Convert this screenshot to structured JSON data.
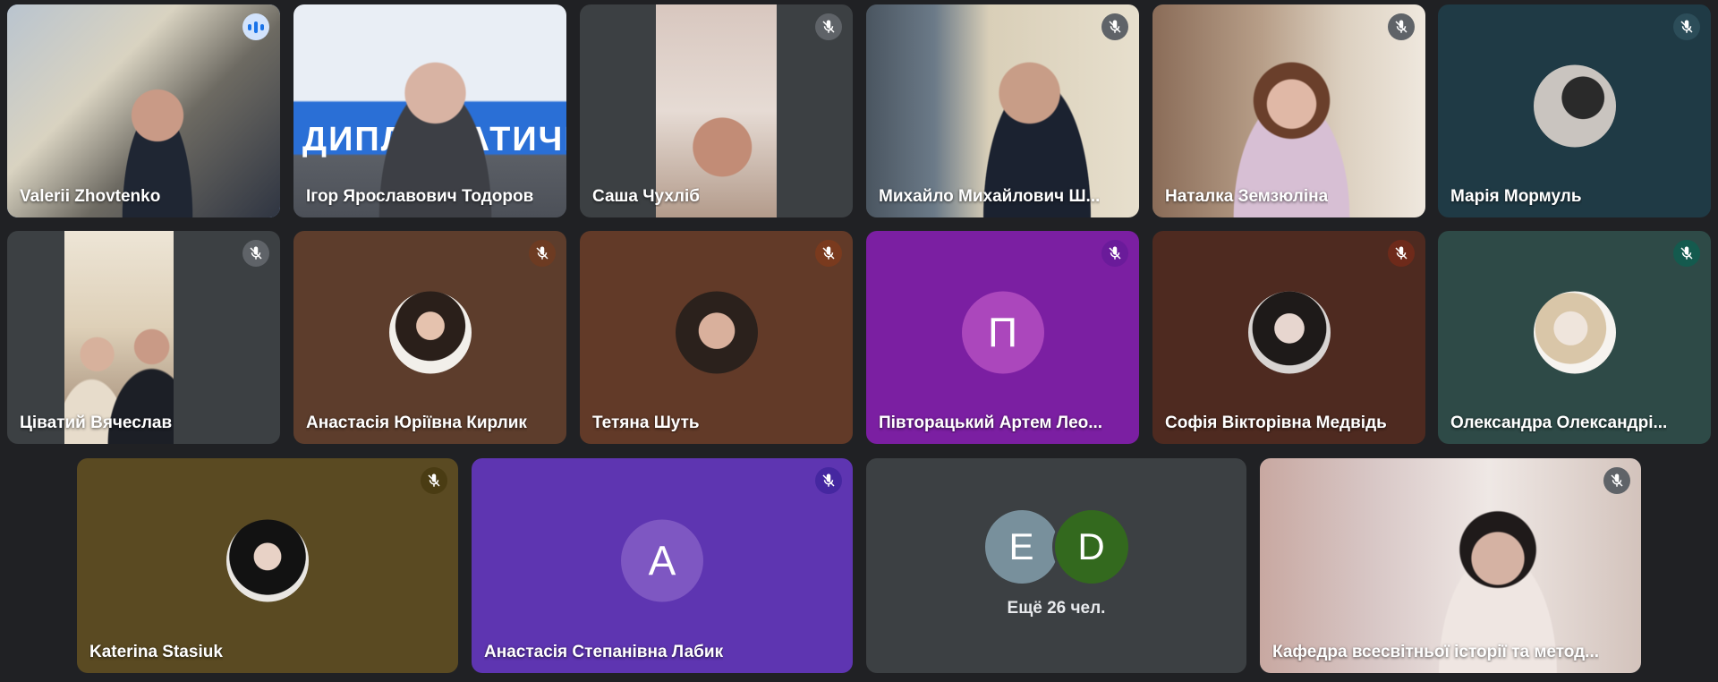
{
  "participants": [
    {
      "name": "Valerii Zhovtenko",
      "speaking": true
    },
    {
      "name": "Ігор Ярославович Тодоров",
      "banner_text": "ДИПЛОМАТИЧНИ"
    },
    {
      "name": "Саша Чухліб",
      "muted": true
    },
    {
      "name": "Михайло Михайлович Ш...",
      "muted": true
    },
    {
      "name": "Наталка Земзюліна",
      "muted": true
    },
    {
      "name": "Марія Мормуль",
      "muted": true
    },
    {
      "name": "Ціватий Вячеслав",
      "muted": true
    },
    {
      "name": "Анастасія Юріївна Кирлик",
      "muted": true
    },
    {
      "name": "Тетяна Шуть",
      "muted": true
    },
    {
      "name": "Півторацький Артем Лео...",
      "muted": true,
      "initial": "П"
    },
    {
      "name": "Софія Вікторівна Медвідь",
      "muted": true
    },
    {
      "name": "Олександра Олександрі...",
      "muted": true
    },
    {
      "name": "Katerina Stasiuk",
      "muted": true
    },
    {
      "name": "Анастасія Степанівна Лабик",
      "muted": true,
      "initial": "A"
    },
    {
      "name": "Кафедра всесвітньої історії та метод...",
      "muted": true
    }
  ],
  "more_tile": {
    "initials": [
      "E",
      "D"
    ],
    "label": "Ещё 26 чел."
  },
  "colors": {
    "background": "#202124",
    "speaking_outline": "#8ab4f8",
    "purple_tile": "#7b1fa2",
    "violet_tile": "#5e35b1",
    "avatar_e": "#78909c",
    "avatar_d": "#33691e"
  },
  "icons": [
    "mic-off-icon",
    "speaking-indicator-icon"
  ]
}
